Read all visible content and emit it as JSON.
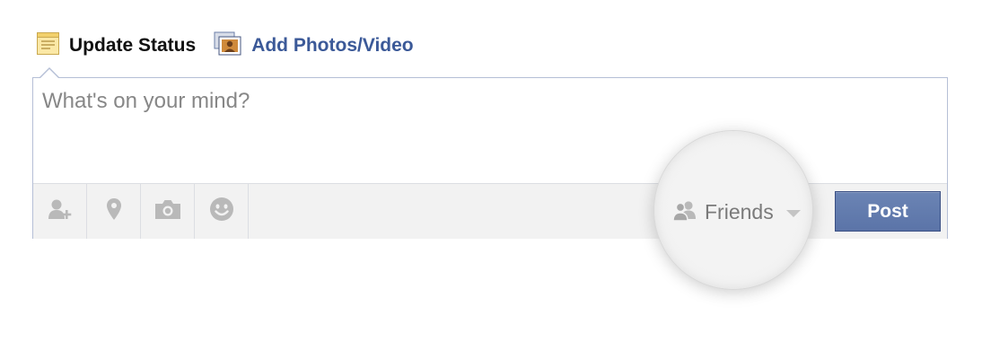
{
  "tabs": {
    "update_status": "Update Status",
    "add_photos": "Add Photos/Video"
  },
  "composer": {
    "placeholder": "What's on your mind?"
  },
  "toolbar": {
    "icons": [
      "tag-friends-icon",
      "location-icon",
      "camera-icon",
      "smiley-icon"
    ]
  },
  "audience": {
    "label": "Friends",
    "icon": "friends-icon"
  },
  "post_button": {
    "label": "Post"
  },
  "colors": {
    "brand_blue": "#3b5998",
    "post_button": "#5b74a8",
    "composer_border": "#b5bfd6",
    "toolbar_bg": "#f2f2f2",
    "icon_gray": "#b9b9b9"
  }
}
